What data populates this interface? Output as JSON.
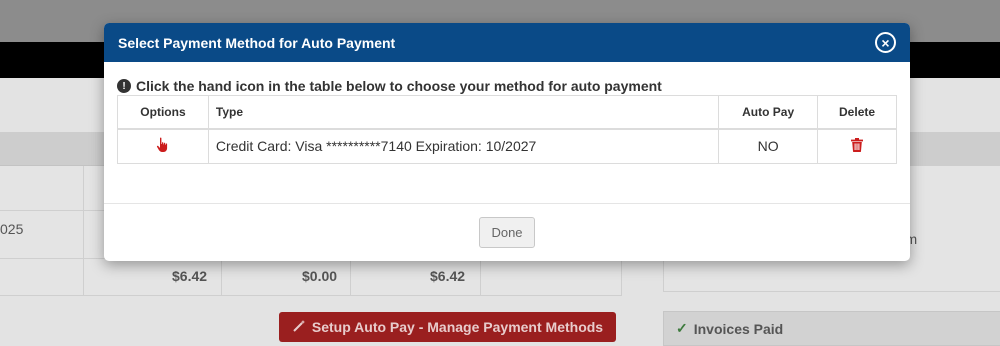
{
  "modal": {
    "title": "Select Payment Method for Auto Payment",
    "close_icon": "close-circle-icon",
    "notice_icon": "exclamation-circle-icon",
    "notice": "Click the hand icon in the table below to choose your method for auto payment",
    "table": {
      "headers": [
        "Options",
        "Type",
        "Auto Pay",
        "Delete"
      ],
      "rows": [
        {
          "option_icon": "hand-pointer-icon",
          "type": "Credit Card: Visa **********7140 Expiration: 10/2027",
          "auto_pay": "NO",
          "delete_icon": "trash-icon"
        }
      ]
    },
    "done_label": "Done"
  },
  "background": {
    "date_fragment": "025",
    "amounts": [
      "$6.42",
      "$0.00",
      "$6.42"
    ],
    "setup_button": "Setup Auto Pay - Manage Payment Methods",
    "right_text": "ns.com",
    "invoices_label": "Invoices Paid"
  },
  "colors": {
    "header": "#0a4a87",
    "action_red": "#cc1d1d",
    "backdrop": "#e3e3e3"
  }
}
